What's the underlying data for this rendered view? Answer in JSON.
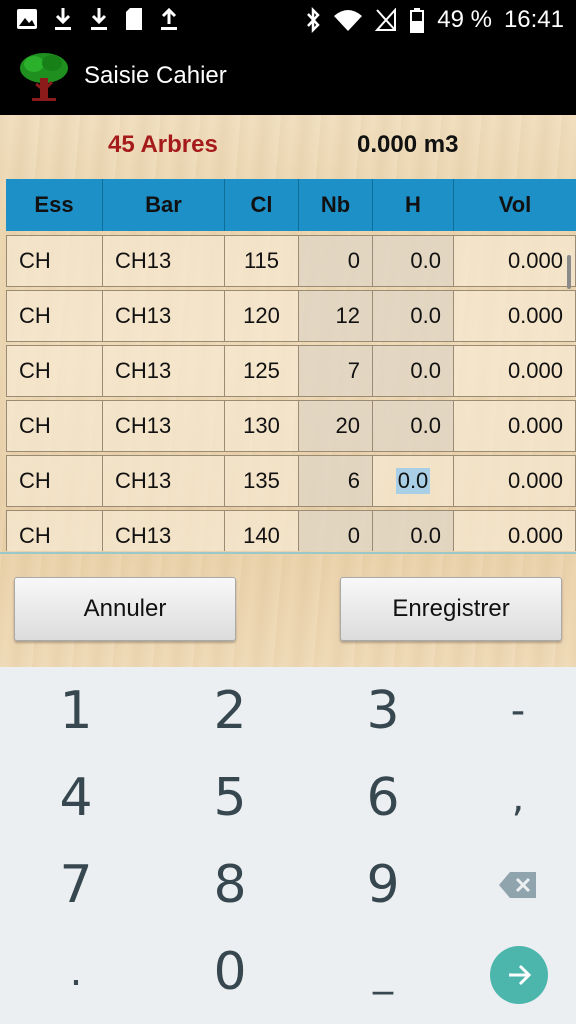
{
  "status_bar": {
    "battery_percent": "49 %",
    "time": "16:41",
    "notification_icons": [
      "image-icon",
      "download-icon",
      "download-icon",
      "sd-card-icon",
      "upload-icon"
    ],
    "system_icons": [
      "bluetooth-icon",
      "wifi-icon",
      "no-signal-icon",
      "battery-icon"
    ]
  },
  "titlebar": {
    "title": "Saisie Cahier",
    "logo_icon": "tree-icon"
  },
  "summary": {
    "trees": "45 Arbres",
    "volume": "0.000 m3"
  },
  "grid": {
    "columns": [
      "Ess",
      "Bar",
      "Cl",
      "Nb",
      "H",
      "Vol"
    ],
    "rows": [
      [
        "CH",
        "CH13",
        "115",
        "0",
        "0.0",
        "0.000"
      ],
      [
        "CH",
        "CH13",
        "120",
        "12",
        "0.0",
        "0.000"
      ],
      [
        "CH",
        "CH13",
        "125",
        "7",
        "0.0",
        "0.000"
      ],
      [
        "CH",
        "CH13",
        "130",
        "20",
        "0.0",
        "0.000"
      ],
      [
        "CH",
        "CH13",
        "135",
        "6",
        "0.0",
        "0.000"
      ],
      [
        "CH",
        "CH13",
        "140",
        "0",
        "0.0",
        "0.000"
      ]
    ],
    "selected_row": 4,
    "selected_col": "H"
  },
  "buttons": {
    "cancel": "Annuler",
    "save": "Enregistrer"
  },
  "keyboard": {
    "keys": [
      "1",
      "2",
      "3",
      "-",
      "4",
      "5",
      "6",
      ",",
      "7",
      "8",
      "9",
      "backspace",
      ".",
      "0",
      "_",
      "enter"
    ],
    "accent": "#4db6ac"
  }
}
